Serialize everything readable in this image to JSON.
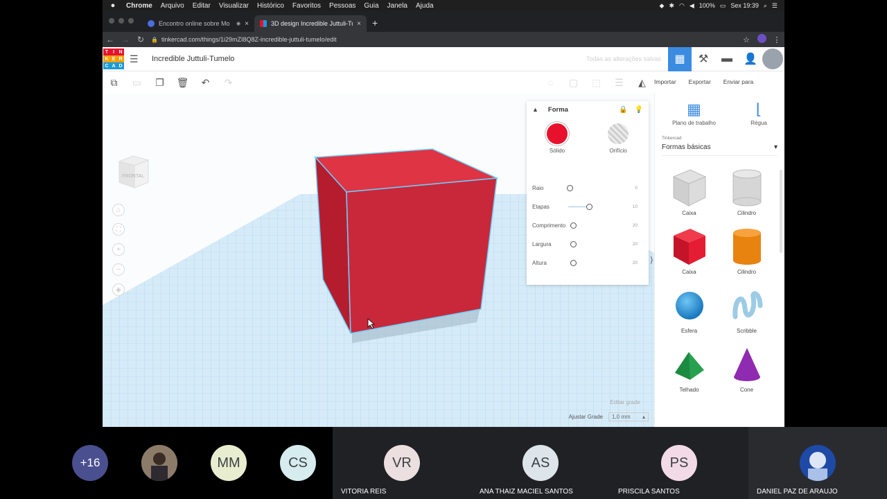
{
  "menubar": {
    "app": "Chrome",
    "items": [
      "Arquivo",
      "Editar",
      "Visualizar",
      "Histórico",
      "Favoritos",
      "Pessoas",
      "Guia",
      "Janela",
      "Ajuda"
    ],
    "battery": "100%",
    "clock": "Sex 19:39"
  },
  "browser": {
    "tabs": [
      {
        "title": "Encontro online sobre Mo",
        "close": "×",
        "active": false
      },
      {
        "title": "3D design Incredible Juttuli-Tu",
        "close": "×",
        "active": true
      }
    ],
    "new_tab": "+",
    "url": "tinkercad.com/things/1i29mZI8Q8Z-incredible-juttuli-tumelo/edit"
  },
  "app": {
    "logo_letters": [
      "T",
      "I",
      "N",
      "K",
      "E",
      "R",
      "C",
      "A",
      "D"
    ],
    "design_title": "Incredible Juttuli-Tumelo",
    "saved_status": "Todas as alterações salvas",
    "actions": [
      "Importar",
      "Exportar",
      "Enviar para"
    ]
  },
  "navcube": {
    "label": "FRONTAL"
  },
  "shape_panel": {
    "title": "Forma",
    "types": [
      {
        "label": "Sólido",
        "color": "#e8112d"
      },
      {
        "label": "Orifício",
        "color": "#bdbdbd"
      }
    ],
    "props": [
      {
        "label": "Raio",
        "value": "0"
      },
      {
        "label": "Etapas",
        "value": "10"
      },
      {
        "label": "Comprimento",
        "value": "20"
      },
      {
        "label": "Largura",
        "value": "20"
      },
      {
        "label": "Altura",
        "value": "20"
      }
    ]
  },
  "grid": {
    "edit_label": "Editar grade",
    "snap_label": "Ajustar Grade",
    "snap_value": "1,0 mm"
  },
  "sidebar": {
    "tools": [
      "Plano de trabalho",
      "Régua"
    ],
    "category_small": "Tinkercad",
    "category": "Formas básicas",
    "shapes": [
      {
        "label": "Caixa",
        "icon": "box-hole-icon"
      },
      {
        "label": "Cilindro",
        "icon": "cylinder-hole-icon"
      },
      {
        "label": "Caixa",
        "icon": "box-icon"
      },
      {
        "label": "Cilindro",
        "icon": "cylinder-icon"
      },
      {
        "label": "Esfera",
        "icon": "sphere-icon"
      },
      {
        "label": "Scribble",
        "icon": "scribble-icon"
      },
      {
        "label": "Telhado",
        "icon": "roof-icon"
      },
      {
        "label": "Cone",
        "icon": "cone-icon"
      }
    ]
  },
  "meeting": {
    "more_count": "+16",
    "participants": [
      {
        "initials": "MM",
        "name": ""
      },
      {
        "initials": "CS",
        "name": ""
      },
      {
        "initials": "VR",
        "name": "VITORIA REIS"
      },
      {
        "initials": "AS",
        "name": "ANA THAIZ MACIEL SANTOS"
      },
      {
        "initials": "PS",
        "name": "PRISCILA SANTOS"
      },
      {
        "initials": "",
        "name": "DANIEL PAZ DE ARAUJO"
      }
    ]
  }
}
